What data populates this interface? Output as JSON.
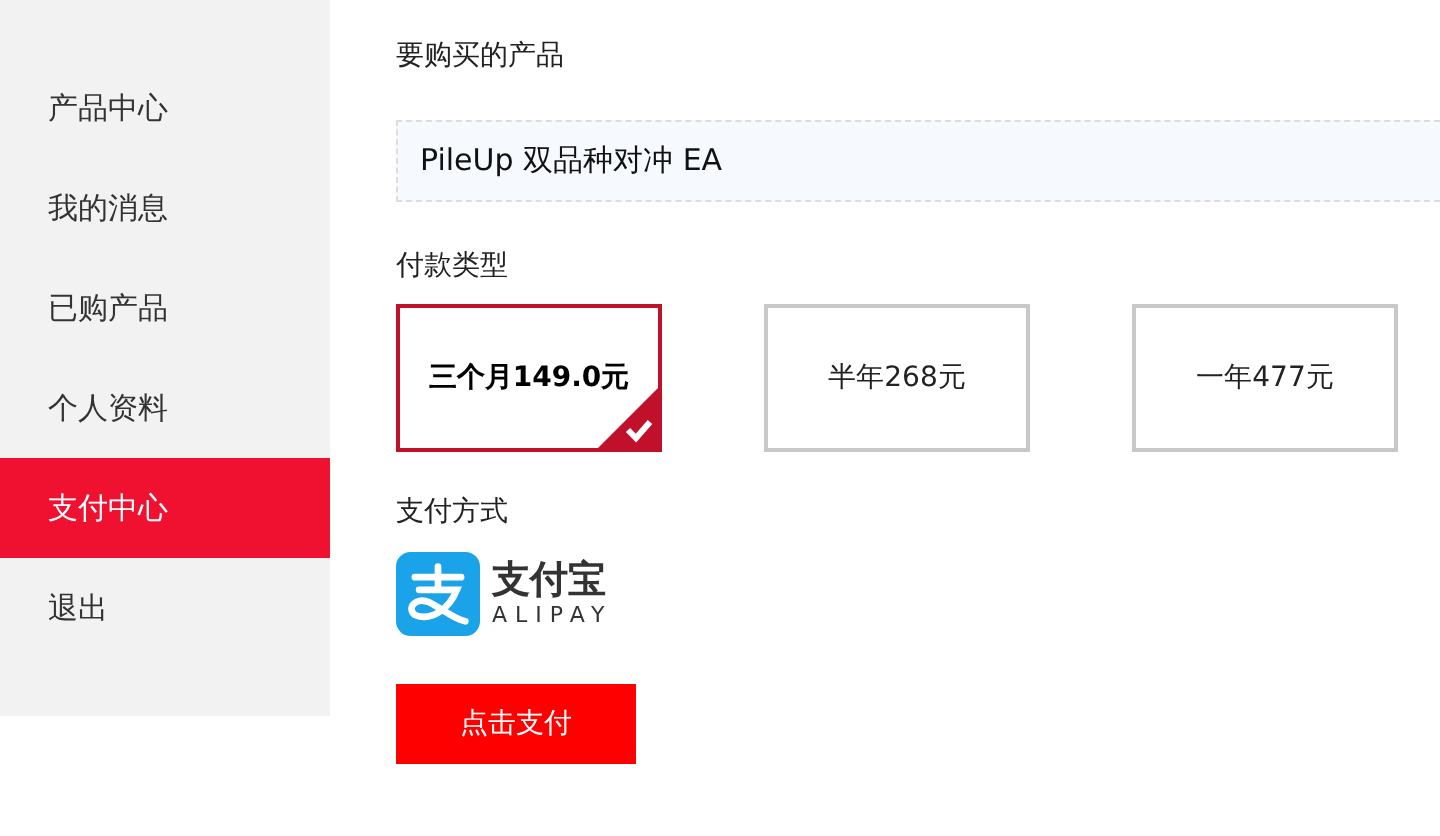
{
  "sidebar": {
    "items": [
      {
        "label": "产品中心",
        "selected": false
      },
      {
        "label": "我的消息",
        "selected": false
      },
      {
        "label": "已购产品",
        "selected": false
      },
      {
        "label": "个人资料",
        "selected": false
      },
      {
        "label": "支付中心",
        "selected": true
      },
      {
        "label": "退出",
        "selected": false
      }
    ]
  },
  "product": {
    "label": "要购买的产品",
    "value": "PileUp 双品种对冲 EA"
  },
  "payment_type": {
    "label": "付款类型",
    "options": [
      {
        "label": "三个月149.0元",
        "selected": true
      },
      {
        "label": "半年268元",
        "selected": false
      },
      {
        "label": "一年477元",
        "selected": false
      }
    ]
  },
  "payment_method": {
    "label": "支付方式",
    "logo": {
      "name": "支付宝",
      "sub": "ALIPAY"
    }
  },
  "pay_button": "点击支付"
}
